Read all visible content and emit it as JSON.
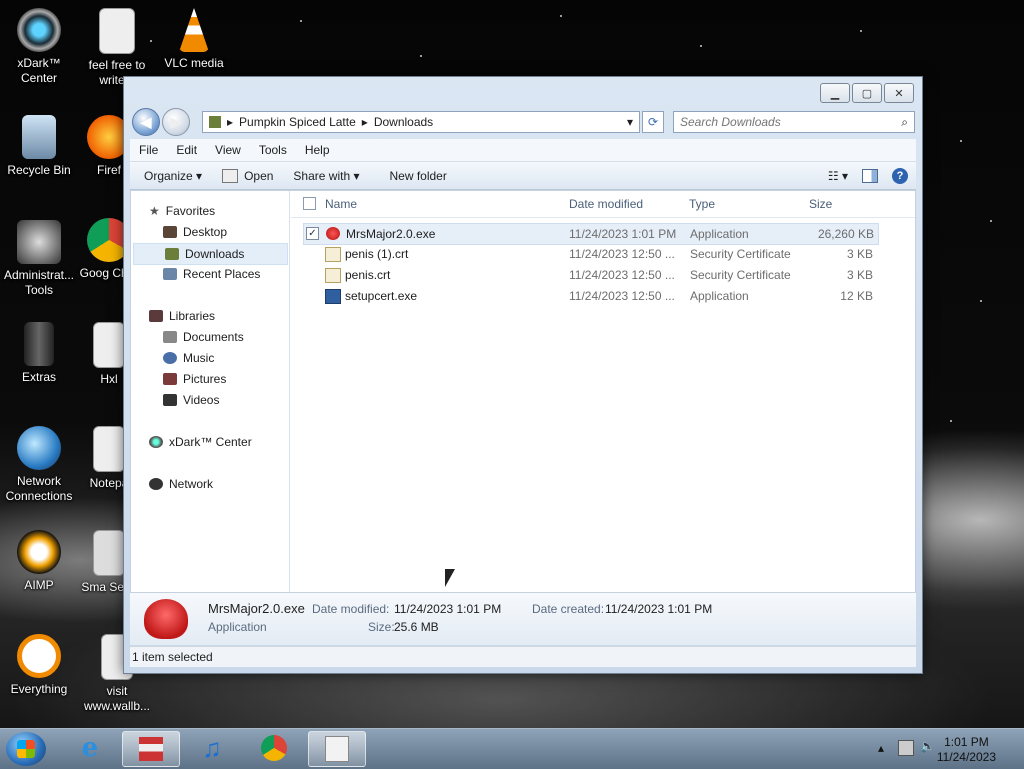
{
  "desktop": {
    "icons_left": [
      "xDark™ Center",
      "Recycle Bin",
      "Administrat... Tools",
      "Extras",
      "Network Connections",
      "AIMP",
      "Everything"
    ],
    "icons_mid": [
      "feel free to write a",
      "Firef",
      "Goog Chro",
      "Hxl",
      "Notepa",
      "Sma Servi",
      "visit www.wallb..."
    ],
    "icon_top3": "VLC media"
  },
  "window": {
    "breadcrumb": [
      "Pumpkin Spiced Latte",
      "Downloads"
    ],
    "search_placeholder": "Search Downloads",
    "menu": [
      "File",
      "Edit",
      "View",
      "Tools",
      "Help"
    ],
    "commands": {
      "organize": "Organize ▾",
      "open": "Open",
      "share": "Share with ▾",
      "new_folder": "New folder"
    },
    "nav": {
      "favorites": "Favorites",
      "desktop": "Desktop",
      "downloads": "Downloads",
      "recent": "Recent Places",
      "libraries": "Libraries",
      "documents": "Documents",
      "music": "Music",
      "pictures": "Pictures",
      "videos": "Videos",
      "xdark": "xDark™ Center",
      "network": "Network"
    },
    "columns": {
      "name": "Name",
      "date": "Date modified",
      "type": "Type",
      "size": "Size"
    },
    "files": [
      {
        "name": "MrsMajor2.0.exe",
        "date": "11/24/2023 1:01 PM",
        "type": "Application",
        "size": "26,260 KB"
      },
      {
        "name": "penis (1).crt",
        "date": "11/24/2023 12:50 ...",
        "type": "Security Certificate",
        "size": "3 KB"
      },
      {
        "name": "penis.crt",
        "date": "11/24/2023 12:50 ...",
        "type": "Security Certificate",
        "size": "3 KB"
      },
      {
        "name": "setupcert.exe",
        "date": "11/24/2023 12:50 ...",
        "type": "Application",
        "size": "12 KB"
      }
    ],
    "details": {
      "filename": "MrsMajor2.0.exe",
      "filetype": "Application",
      "modified_label": "Date modified:",
      "modified": "11/24/2023 1:01 PM",
      "created_label": "Date created:",
      "created": "11/24/2023 1:01 PM",
      "size_label": "Size:",
      "size": "25.6 MB"
    },
    "status": "1 item selected"
  },
  "taskbar": {
    "time": "1:01 PM",
    "date": "11/24/2023"
  }
}
